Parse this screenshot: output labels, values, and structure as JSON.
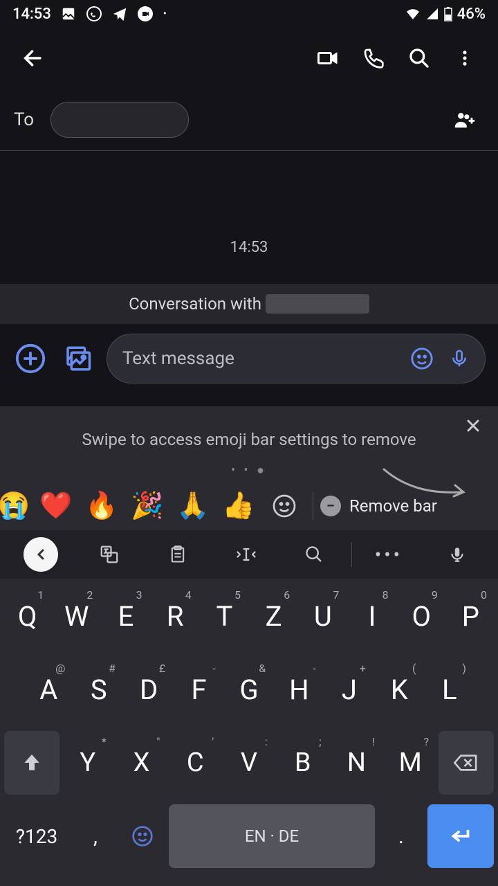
{
  "status": {
    "time": "14:53",
    "battery": "46%"
  },
  "to_field": {
    "label": "To"
  },
  "conversation": {
    "timestamp": "14:53",
    "banner_prefix": "Conversation with"
  },
  "compose": {
    "placeholder": "Text message"
  },
  "tip": {
    "text": "Swipe to access emoji bar settings to remove"
  },
  "emoji_bar": {
    "emojis": [
      "😭",
      "❤️",
      "🔥",
      "🎉",
      "🙏",
      "👍",
      "☺"
    ],
    "remove_label": "Remove bar"
  },
  "keyboard": {
    "row1": [
      {
        "k": "Q",
        "h": "1"
      },
      {
        "k": "W",
        "h": "2"
      },
      {
        "k": "E",
        "h": "3"
      },
      {
        "k": "R",
        "h": "4"
      },
      {
        "k": "T",
        "h": "5"
      },
      {
        "k": "Z",
        "h": "6"
      },
      {
        "k": "U",
        "h": "7"
      },
      {
        "k": "I",
        "h": "8"
      },
      {
        "k": "O",
        "h": "9"
      },
      {
        "k": "P",
        "h": "0"
      }
    ],
    "row2": [
      {
        "k": "A",
        "h": "@"
      },
      {
        "k": "S",
        "h": "#"
      },
      {
        "k": "D",
        "h": "£"
      },
      {
        "k": "F",
        "h": "-"
      },
      {
        "k": "G",
        "h": "&"
      },
      {
        "k": "H",
        "h": "-"
      },
      {
        "k": "J",
        "h": "+"
      },
      {
        "k": "K",
        "h": "("
      },
      {
        "k": "L",
        "h": ")"
      }
    ],
    "row3": [
      {
        "k": "Y",
        "h": "*"
      },
      {
        "k": "X",
        "h": "\""
      },
      {
        "k": "C",
        "h": "'"
      },
      {
        "k": "V",
        "h": ":"
      },
      {
        "k": "B",
        "h": ";"
      },
      {
        "k": "N",
        "h": "!"
      },
      {
        "k": "M",
        "h": "?"
      }
    ],
    "sym_label": "?123",
    "space_label": "EN · DE",
    "comma": ",",
    "period": "."
  }
}
